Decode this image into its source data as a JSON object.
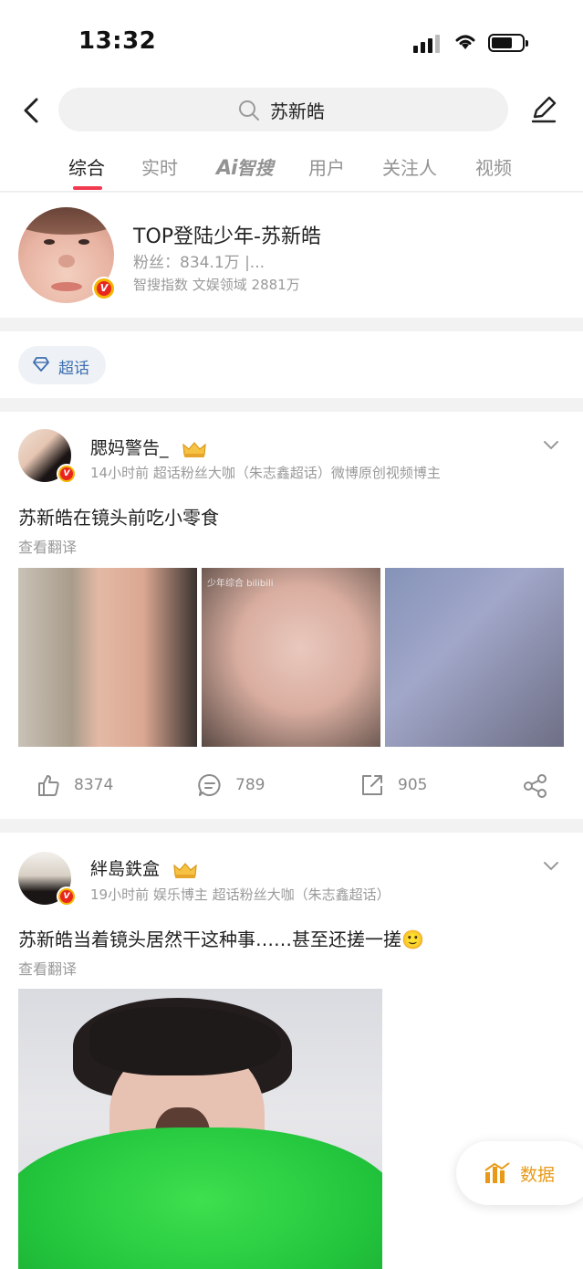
{
  "status_bar": {
    "time": "13:32"
  },
  "search": {
    "query": "苏新皓"
  },
  "tabs": [
    {
      "label": "综合"
    },
    {
      "label": "实时"
    },
    {
      "label_ai": "Ai",
      "label_rest": "智搜"
    },
    {
      "label": "用户"
    },
    {
      "label": "关注人"
    },
    {
      "label": "视频"
    }
  ],
  "user_card": {
    "name": "TOP登陆少年-苏新皓",
    "fans": "粉丝：834.1万 |...",
    "meta": "智搜指数 文娱领域 2881万",
    "verified_badge": "V"
  },
  "super_topic": {
    "label": "超话"
  },
  "posts": [
    {
      "author": "腮妈警告_",
      "meta": "14小时前  超话粉丝大咖（朱志鑫超话）微博原创视频博主",
      "text": "苏新皓在镜头前吃小零食",
      "translate": "查看翻译",
      "image_label": "少年综合 bilibili",
      "likes": "8374",
      "comments": "789",
      "reposts": "905"
    },
    {
      "author": "絆島鉄盒",
      "meta": "19小时前  娱乐博主 超话粉丝大咖（朱志鑫超话）",
      "text": "苏新皓当着镜头居然干这种事……甚至还搓一搓🙂",
      "translate": "查看翻译"
    }
  ],
  "floating": {
    "data_label": "数据"
  },
  "colors": {
    "accent_red": "#f23a4f",
    "topic_blue": "#3d6fb0",
    "data_orange": "#e89a17",
    "verified_gold": "#f5b400"
  }
}
